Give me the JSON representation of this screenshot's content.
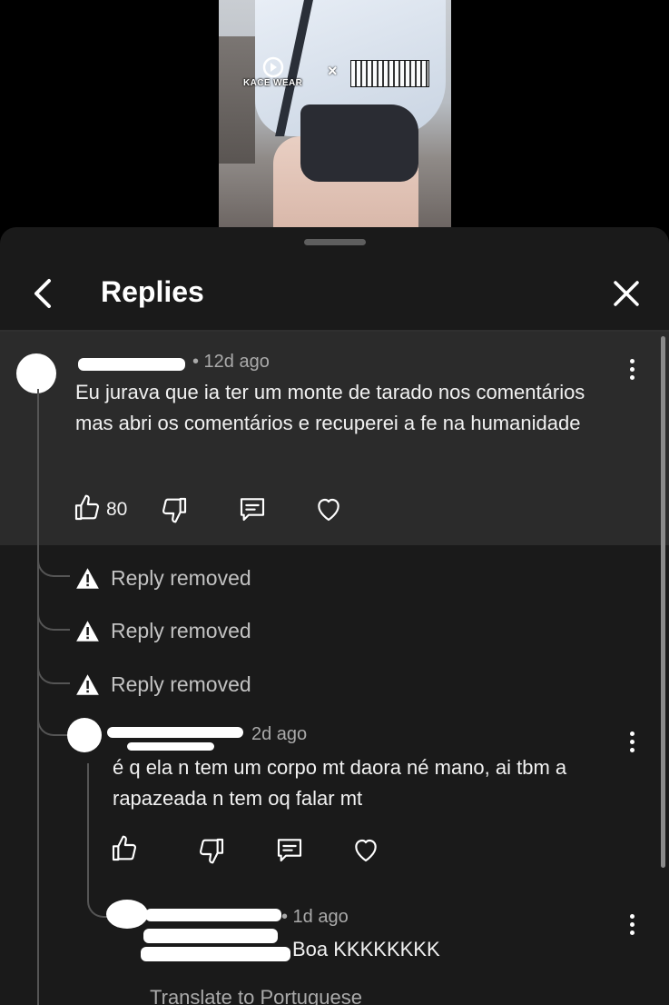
{
  "video": {
    "brand_left": "KACE WEAR",
    "brand_x": "×"
  },
  "header": {
    "title": "Replies"
  },
  "main_comment": {
    "time": "• 12d ago",
    "text": "Eu jurava que ia ter um monte de tarado nos comentários mas abri os comentários e recuperei a fe na humanidade",
    "likes": "80"
  },
  "removed": [
    {
      "label": "Reply removed"
    },
    {
      "label": "Reply removed"
    },
    {
      "label": "Reply removed"
    }
  ],
  "reply1": {
    "time": "2d ago",
    "text": "é q ela n tem um corpo mt daora né mano, ai tbm a rapazeada n tem oq falar mt"
  },
  "reply2": {
    "time": "• 1d ago",
    "text": "Boa KKKKKKKK",
    "translate": "Translate to Portuguese"
  },
  "colors": {
    "sheet_bg": "#1a1a1a",
    "highlight_bg": "#2b2b2b",
    "thread_line": "#555555"
  }
}
